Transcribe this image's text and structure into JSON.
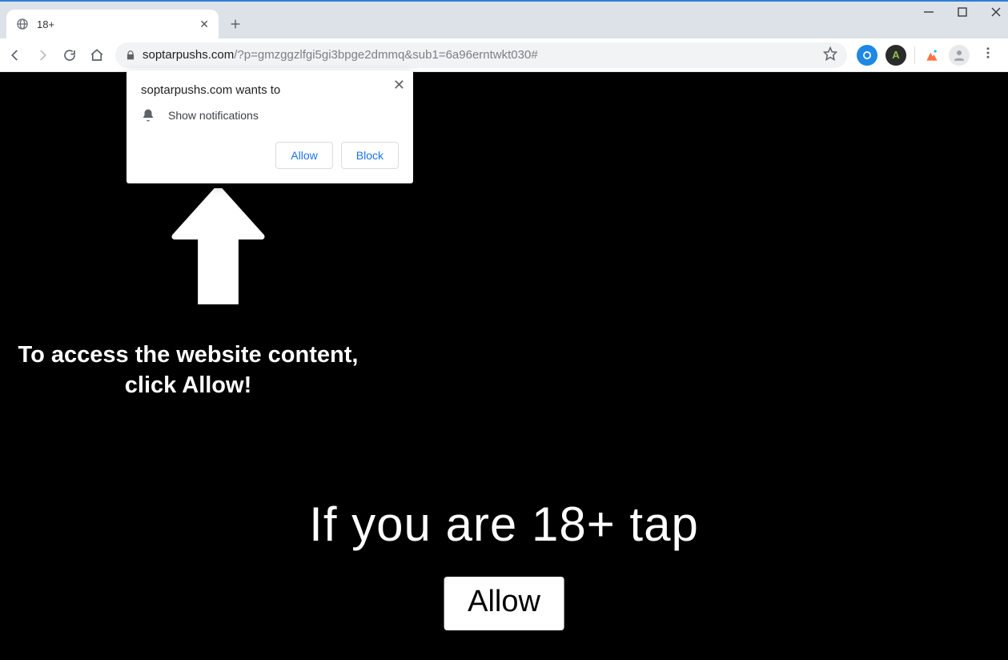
{
  "tab": {
    "title": "18+"
  },
  "url": {
    "host": "soptarpushs.com",
    "path": "/?p=gmzggzlfgi5gi3bpge2dmmq&sub1=6a96erntwkt030#"
  },
  "permission_prompt": {
    "origin_text": "soptarpushs.com wants to",
    "capability_text": "Show notifications",
    "allow_label": "Allow",
    "block_label": "Block"
  },
  "page": {
    "instruction_text": "To access the website content, click Allow!",
    "age_line": "If you are 18+ tap",
    "allow_button_label": "Allow"
  },
  "icons": {
    "globe": "globe-icon",
    "close": "×",
    "plus": "+"
  },
  "colors": {
    "link_blue": "#1a73e8",
    "page_bg": "#000000"
  }
}
